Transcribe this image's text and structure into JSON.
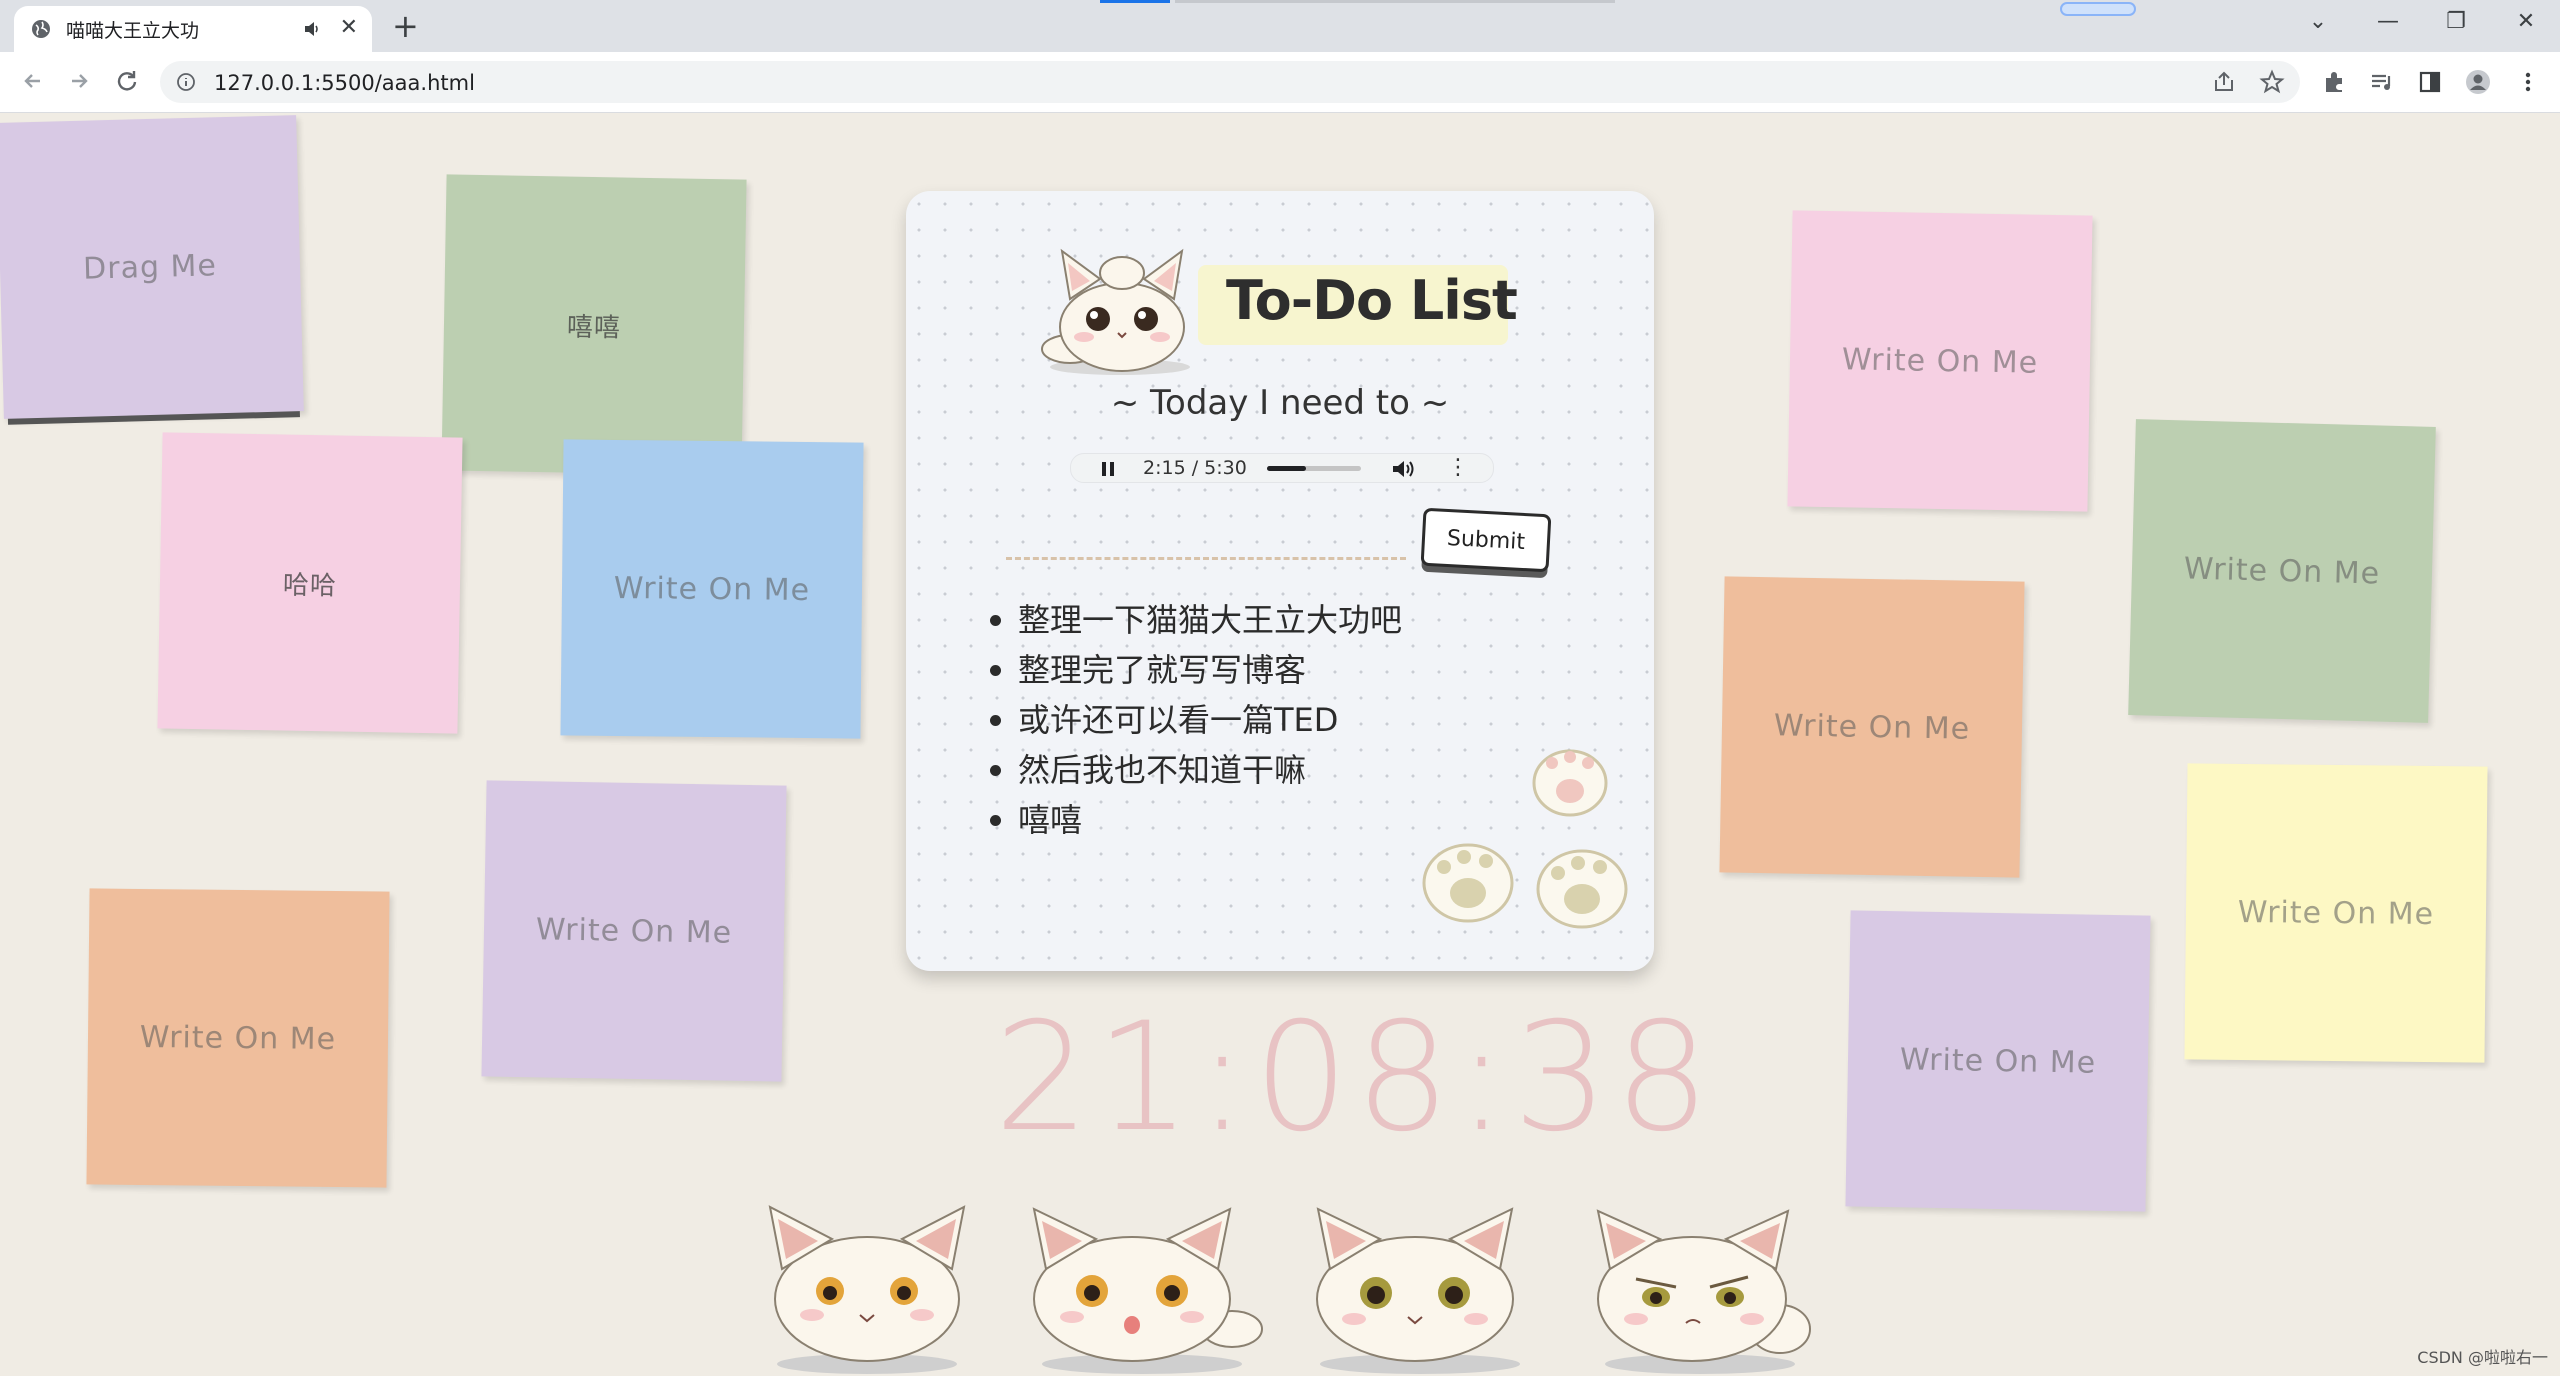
{
  "browser": {
    "tab_title": "喵喵大王立大功",
    "url": "127.0.0.1:5500/aaa.html",
    "new_tab_symbol": "+",
    "tab_close_symbol": "✕",
    "window_controls": [
      "⌄",
      "—",
      "❐",
      "✕"
    ]
  },
  "todo": {
    "title": "To-Do List",
    "subtitle": "~ Today I need to ~",
    "audio": {
      "time": "2:15 / 5:30",
      "progress": 0.41
    },
    "submit_label": "Submit",
    "items": [
      "整理一下猫猫大王立大功吧",
      "整理完了就写写博客",
      "或许还可以看一篇TED",
      "然后我也不知道干嘛",
      "嘻嘻"
    ]
  },
  "notes": [
    {
      "text": "Drag Me",
      "color": "#d8c9e4"
    },
    {
      "text": "嘻嘻",
      "color": "#bccfb1"
    },
    {
      "text": "哈哈",
      "color": "#f6d0e3"
    },
    {
      "text": "Write On Me",
      "color": "#a9ccee"
    },
    {
      "text": "Write On Me",
      "color": "#d8c9e4"
    },
    {
      "text": "Write On Me",
      "color": "#efbe9c"
    },
    {
      "text": "Write On Me",
      "color": "#f6d0e3"
    },
    {
      "text": "Write On Me",
      "color": "#bccfb1"
    },
    {
      "text": "Write On Me",
      "color": "#efbe9c"
    },
    {
      "text": "Write On Me",
      "color": "#fdf8c4"
    },
    {
      "text": "Write On Me",
      "color": "#d8c9e4"
    }
  ],
  "clock": "21:08:38",
  "watermark": "CSDN @啦啦右一",
  "icons": [
    "globe-icon",
    "speaker-icon",
    "back-icon",
    "forward-icon",
    "reload-icon",
    "info-icon",
    "share-icon",
    "star-icon",
    "extensions-icon",
    "media-icon",
    "sidepanel-icon",
    "profile-icon",
    "menu-icon",
    "cat-icon",
    "paw-icon"
  ]
}
